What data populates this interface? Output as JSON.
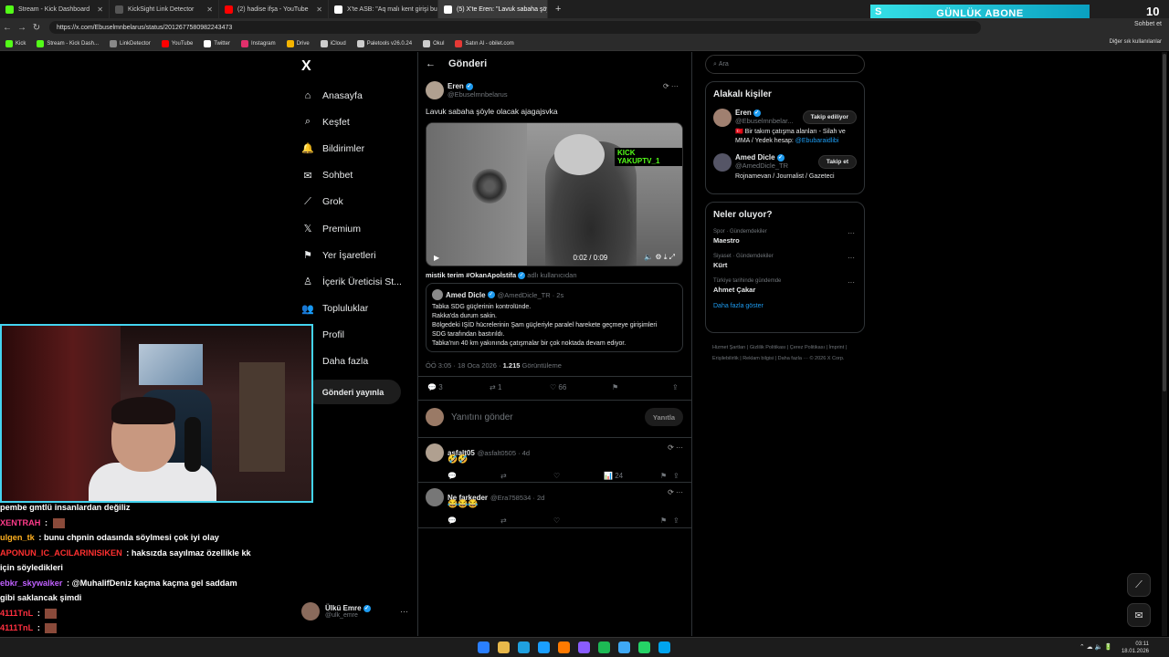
{
  "browser": {
    "tabs": [
      {
        "label": "Stream - Kick Dashboard",
        "color": "#53fc18"
      },
      {
        "label": "KickSight Link Detector",
        "color": "#555555"
      },
      {
        "label": "(2) hadise ifşa - YouTube",
        "color": "#ff0000"
      },
      {
        "label": "X'te ASB: \"Aq malı kent girişi buna...",
        "color": "#ffffff"
      },
      {
        "label": "(5) X'te Eren: \"Lavuk sabaha şöyle...",
        "color": "#ffffff"
      }
    ],
    "new_tab": "+",
    "url": "https://x.com/Ebuselmnbelarus/status/2012677580982243473",
    "sohbet": "Sohbet et",
    "bookmarks": [
      {
        "label": "Kick",
        "color": "#53fc18"
      },
      {
        "label": "Stream - Kick Dash...",
        "color": "#53fc18"
      },
      {
        "label": "LinkDetector",
        "color": "#888888"
      },
      {
        "label": "YouTube",
        "color": "#ff0000"
      },
      {
        "label": "Twitter",
        "color": "#ffffff"
      },
      {
        "label": "Instagram",
        "color": "#e1306c"
      },
      {
        "label": "Drive",
        "color": "#f4b400"
      },
      {
        "label": "iCloud",
        "color": "#cccccc"
      },
      {
        "label": "Paletools v26.0.24",
        "color": "#cccccc"
      },
      {
        "label": "Okul",
        "color": "#cccccc"
      },
      {
        "label": "Satın Al - obilet.com",
        "color": "#e53935"
      }
    ],
    "bookmarks_right": "Diğer sık kullanılanlar"
  },
  "overlay": {
    "abone_prefix": "S",
    "abone_label": "GÜNLÜK ABONE",
    "abone_count": "10"
  },
  "sidebar": {
    "logo": "X",
    "items": [
      {
        "label": "Anasayfa",
        "icon": "⌂"
      },
      {
        "label": "Keşfet",
        "icon": "⌕"
      },
      {
        "label": "Bildirimler",
        "icon": "🔔"
      },
      {
        "label": "Sohbet",
        "icon": "✉"
      },
      {
        "label": "Grok",
        "icon": "⟋"
      },
      {
        "label": "Premium",
        "icon": "𝕏"
      },
      {
        "label": "Yer İşaretleri",
        "icon": "⚑"
      },
      {
        "label": "İçerik Üreticisi St...",
        "icon": "♙"
      },
      {
        "label": "Topluluklar",
        "icon": "👥"
      },
      {
        "label": "Profil",
        "icon": "♟"
      },
      {
        "label": "Daha fazla",
        "icon": "⋯"
      }
    ],
    "post_button": "Gönderi yayınla",
    "account": {
      "name": "Ülkü Emre",
      "handle": "@ulk_emre",
      "dots": "···"
    }
  },
  "main": {
    "header": "Gönderi",
    "back": "←",
    "tweet": {
      "author": "Eren",
      "handle": "@Ebuselmnbelarus",
      "icons": "⟳  ···",
      "text": "Lavuk sabaha şöyle olacak ajagajsvka",
      "video": {
        "watermark": "KICK YAKUPTV_1",
        "time": "0:02 / 0:09",
        "play": "▶",
        "controls": "🔈  ⚙  ⤓  ⤢"
      },
      "community": "mistik terim #OkanApoİstifa",
      "community_suffix": "adlı kullanıcıdan",
      "quote": {
        "author": "Amed Dicle",
        "handle": "@AmedDicle_TR · 2s",
        "lines": [
          "Tabka SDG güçlerinin kontrolünde.",
          "Rakka'da durum sakin.",
          "Bölgedeki IŞİD hücrelerinin Şam güçleriyle paralel harekete geçmeye girişimleri",
          "SDG tarafından bastırıldı.",
          "Tabka'nın 40 km yakınında çatışmalar bir çok noktada devam ediyor."
        ]
      },
      "meta_time": "ÖÖ 3:05 · 18 Oca 2026 · ",
      "meta_views": "1.215",
      "meta_views_label": " Görüntüleme",
      "actions": {
        "reply": "3",
        "retweet": "1",
        "like": "66"
      }
    },
    "reply_box": {
      "placeholder": "Yanıtını gönder",
      "button": "Yanıtla"
    },
    "replies": [
      {
        "name": "asfalt05",
        "handle": "@asfalt0505 · 4d",
        "text": "🤣🤣",
        "views": "24"
      },
      {
        "name": "Ne farkeder",
        "handle": "@Era758534 · 2d",
        "text": "😂😂😂",
        "views": ""
      }
    ]
  },
  "right": {
    "search_placeholder": "Ara",
    "related_title": "Alakalı kişiler",
    "people": [
      {
        "name": "Eren",
        "handle": "@Ebuselmnbelar...",
        "button": "Takip ediliyor",
        "bio": "Bir takım çatışma alanları - Silah ve",
        "bio2": "MMA / Yedek hesap: ",
        "bio_link": "@Ebubaraidlibi"
      },
      {
        "name": "Amed Dicle",
        "handle": "@AmedDicle_TR",
        "button": "Takip et",
        "bio": "Rojnamevan / Journalist / Gazeteci",
        "bio2": "",
        "bio_link": ""
      }
    ],
    "trends_title": "Neler oluyor?",
    "trends": [
      {
        "cat": "Spor · Gündemdekiler",
        "title": "Maestro"
      },
      {
        "cat": "Siyaset · Gündemdekiler",
        "title": "Kürt"
      },
      {
        "cat": "Türkiye tarihinde gündemde",
        "title": "Ahmet Çakar"
      }
    ],
    "show_more": "Daha fazla göster",
    "footer": "Hizmet Şartları  |  Gizlilik Politikası  |  Çerez Politikası  |  İmprint  |  Erişilebilirlik  |  Reklam bilgisi  |  Daha fazla ···  © 2026 X Corp."
  },
  "stream_chat": [
    {
      "user": "",
      "user_color": "#ffffff",
      "text": "pembe gmtlü insanlardan değiliz",
      "emote": false
    },
    {
      "user": "XENTRAH",
      "user_color": "#ff3b8a",
      "text": "",
      "emote": true
    },
    {
      "user": "ulgen_tk",
      "user_color": "#ffb020",
      "text": "bunu chpnin odasında söylmesi çok iyi olay",
      "emote": false
    },
    {
      "user": "APONUN_IC_ACILARINISIKEN",
      "user_color": "#ff3030",
      "text": "haksızda sayılmaz özellikle kk",
      "emote": false
    },
    {
      "user": "",
      "user_color": "#ffffff",
      "text": "için söyledikleri",
      "emote": false
    },
    {
      "user": "ebkr_skywalker",
      "user_color": "#c060ff",
      "text": "@MuhalifDeniz kaçma kaçma gel saddam",
      "emote": false
    },
    {
      "user": "",
      "user_color": "#ffffff",
      "text": "gibi saklancak şimdi",
      "emote": false
    },
    {
      "user": "4111TnL",
      "user_color": "#ff3040",
      "text": "",
      "emote": true
    },
    {
      "user": "4111TnL",
      "user_color": "#ff3040",
      "text": "",
      "emote": true
    }
  ],
  "taskbar": {
    "time": "03:11",
    "date": "18.01.2026",
    "tray": "⌃  ☁  🔈  🔋",
    "app_colors": [
      "#2a7fff",
      "#e8b84a",
      "#1fa0e0",
      "#1a9fff",
      "#ff7a00",
      "#8a5cff",
      "#1db954",
      "#3fa9f5",
      "#25d366",
      "#00a4ef"
    ]
  }
}
